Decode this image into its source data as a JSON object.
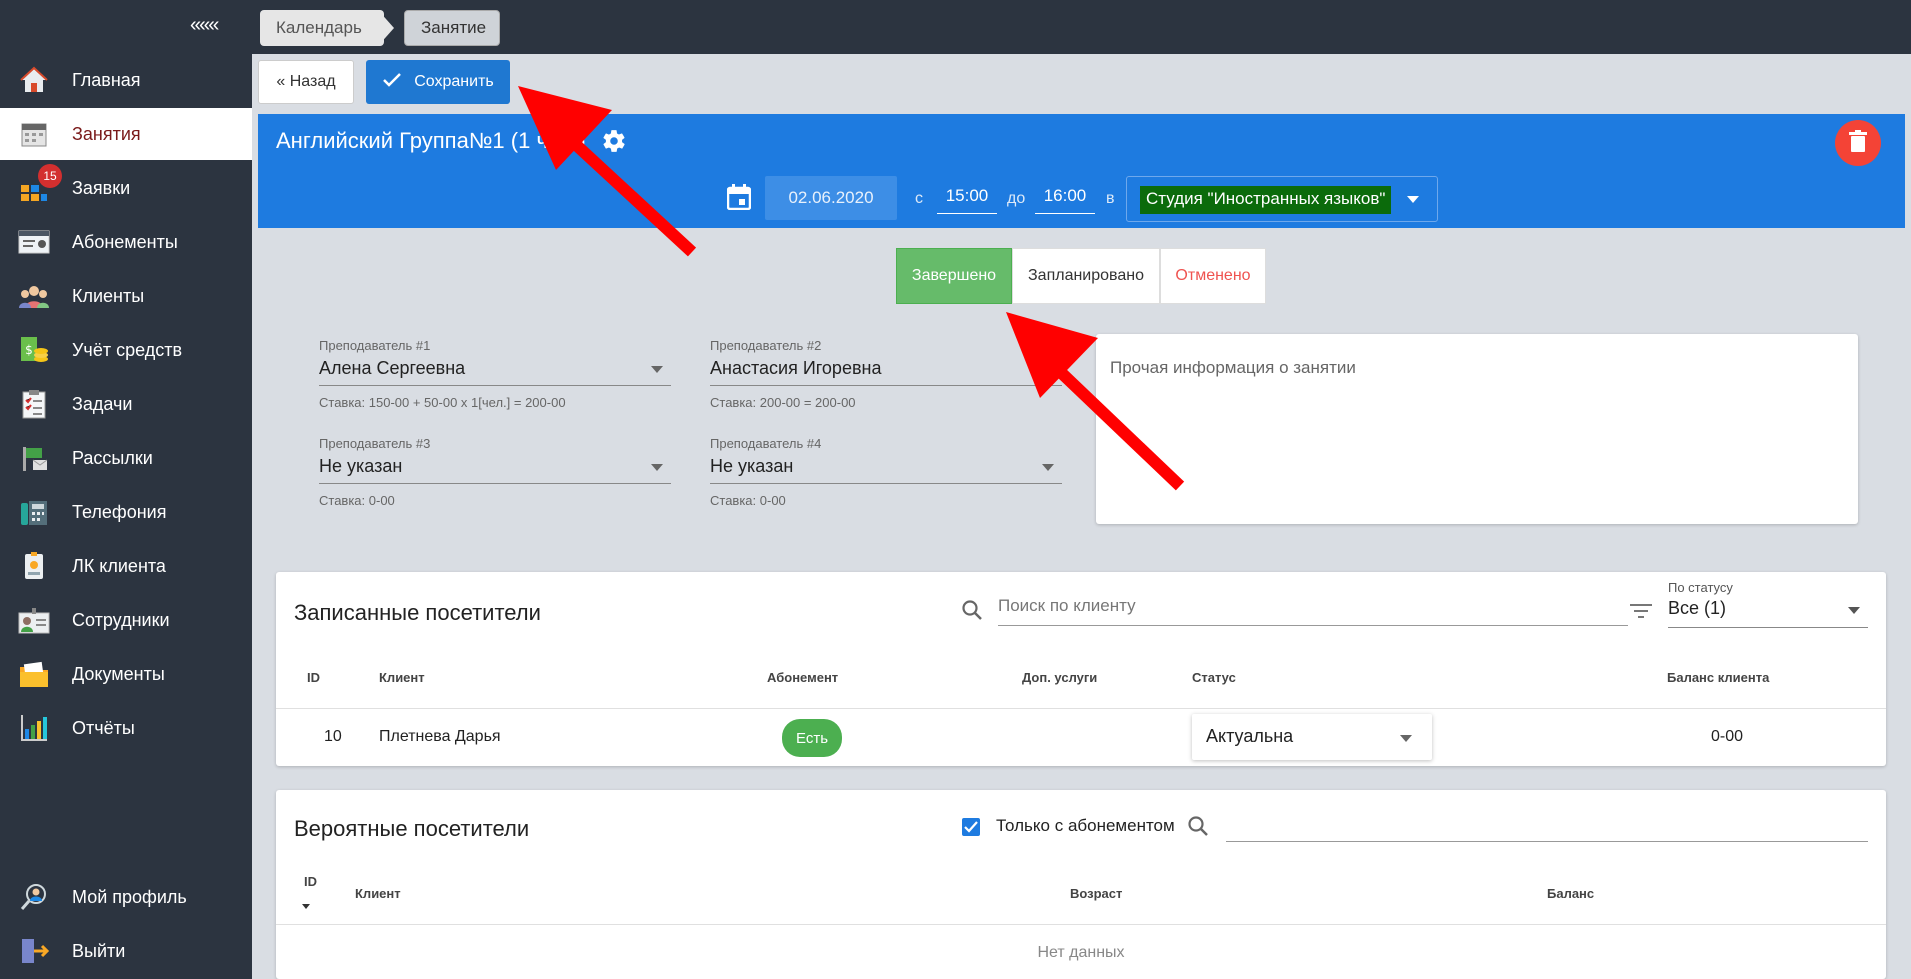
{
  "sidebar": {
    "collapse_label": "«««",
    "items": [
      {
        "label": "Главная",
        "icon": "home-icon"
      },
      {
        "label": "Занятия",
        "icon": "calendar-icon"
      },
      {
        "label": "Заявки",
        "icon": "requests-icon",
        "badge": "15"
      },
      {
        "label": "Абонементы",
        "icon": "subscription-card-icon"
      },
      {
        "label": "Клиенты",
        "icon": "clients-icon"
      },
      {
        "label": "Учёт средств",
        "icon": "money-icon"
      },
      {
        "label": "Задачи",
        "icon": "tasks-icon"
      },
      {
        "label": "Рассылки",
        "icon": "mailing-icon"
      },
      {
        "label": "Телефония",
        "icon": "phone-icon"
      },
      {
        "label": "ЛК клиента",
        "icon": "client-cabinet-icon"
      },
      {
        "label": "Сотрудники",
        "icon": "employees-icon"
      },
      {
        "label": "Документы",
        "icon": "documents-icon"
      },
      {
        "label": "Отчёты",
        "icon": "reports-icon"
      },
      {
        "label": "Мой профиль",
        "icon": "profile-icon"
      },
      {
        "label": "Выйти",
        "icon": "logout-icon"
      }
    ]
  },
  "breadcrumbs": [
    "Календарь",
    "Занятие"
  ],
  "toolbar": {
    "back_label": "« Назад",
    "save_label": "Сохранить"
  },
  "lesson": {
    "title": "Английский Группа№1 (1 чел.)",
    "date": "02.06.2020",
    "from_label": "с",
    "time_from": "15:00",
    "to_label": "до",
    "time_to": "16:00",
    "in_label": "в",
    "place": "Студия \"Иностранных языков\""
  },
  "status_toggle": {
    "done": "Завершено",
    "planned": "Запланировано",
    "cancelled": "Отменено",
    "selected": "Завершено"
  },
  "teachers": [
    {
      "caption": "Преподаватель #1",
      "value": "Алена Сергеевна",
      "rate": "Ставка: 150-00 + 50-00 x 1[чел.] = 200-00"
    },
    {
      "caption": "Преподаватель #2",
      "value": "Анастасия Игоревна",
      "rate": "Ставка: 200-00 = 200-00"
    },
    {
      "caption": "Преподаватель #3",
      "value": "Не указан",
      "rate": "Ставка: 0-00"
    },
    {
      "caption": "Преподаватель #4",
      "value": "Не указан",
      "rate": "Ставка: 0-00"
    }
  ],
  "notes_placeholder": "Прочая информация о занятии",
  "registered": {
    "title": "Записанные посетители",
    "search_placeholder": "Поиск по клиенту",
    "filter_caption": "По статусу",
    "filter_value": "Все (1)",
    "columns": [
      "ID",
      "Клиент",
      "Абонемент",
      "Доп. услуги",
      "Статус",
      "Баланс клиента"
    ],
    "rows": [
      {
        "id": "10",
        "client": "Плетнева Дарья",
        "subscription": "Есть",
        "extra": "",
        "status": "Актуальна",
        "balance": "0-00"
      }
    ]
  },
  "probable": {
    "title": "Вероятные посетители",
    "only_with_subscription": "Только с абонементом",
    "columns": [
      "ID",
      "Клиент",
      "Возраст",
      "Баланс"
    ],
    "empty_text": "Нет данных"
  },
  "colors": {
    "sidebar": "#2c3440",
    "header": "#1e7be0",
    "save": "#1f78d1",
    "done": "#66bb6a",
    "cancel": "#ef5350",
    "delete": "#f44336",
    "arrow": "#ff0000"
  }
}
